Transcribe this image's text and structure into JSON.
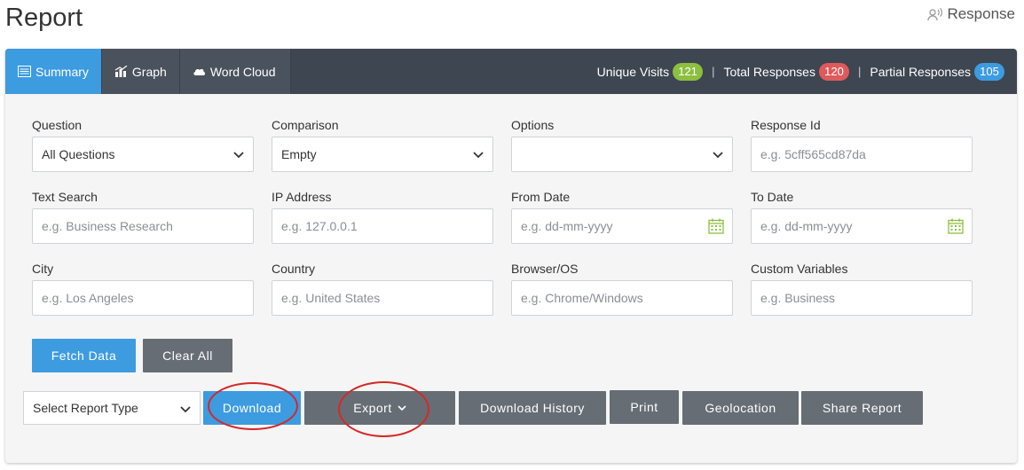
{
  "page": {
    "title": "Report",
    "response_link": "Response"
  },
  "tabs": [
    {
      "label": "Summary",
      "icon": "list-icon",
      "active": true
    },
    {
      "label": "Graph",
      "icon": "bar-chart-icon",
      "active": false
    },
    {
      "label": "Word Cloud",
      "icon": "cloud-icon",
      "active": false
    }
  ],
  "stats": {
    "unique_visits": {
      "label": "Unique Visits",
      "value": "121",
      "color": "#8cbf3f"
    },
    "total_responses": {
      "label": "Total Responses",
      "value": "120",
      "color": "#df5a5a"
    },
    "partial_responses": {
      "label": "Partial Responses",
      "value": "105",
      "color": "#3d9be0"
    }
  },
  "filters": {
    "question": {
      "label": "Question",
      "value": "All Questions"
    },
    "comparison": {
      "label": "Comparison",
      "value": "Empty"
    },
    "options": {
      "label": "Options",
      "value": ""
    },
    "response_id": {
      "label": "Response Id",
      "placeholder": "e.g. 5cff565cd87da"
    },
    "text_search": {
      "label": "Text Search",
      "placeholder": "e.g. Business Research"
    },
    "ip_address": {
      "label": "IP Address",
      "placeholder": "e.g. 127.0.0.1"
    },
    "from_date": {
      "label": "From Date",
      "placeholder": "e.g. dd-mm-yyyy"
    },
    "to_date": {
      "label": "To Date",
      "placeholder": "e.g. dd-mm-yyyy"
    },
    "city": {
      "label": "City",
      "placeholder": "e.g. Los Angeles"
    },
    "country": {
      "label": "Country",
      "placeholder": "e.g. United States"
    },
    "browser_os": {
      "label": "Browser/OS",
      "placeholder": "e.g. Chrome/Windows"
    },
    "custom_variables": {
      "label": "Custom Variables",
      "placeholder": "e.g. Business"
    }
  },
  "actions": {
    "fetch_data": "Fetch Data",
    "clear_all": "Clear All",
    "report_type": "Select Report Type",
    "download": "Download",
    "export": "Export",
    "download_history": "Download History",
    "print": "Print",
    "geolocation": "Geolocation",
    "share_report": "Share Report"
  },
  "colors": {
    "accent": "#3d9be0",
    "tabbar": "#3e4651",
    "button_gray": "#676d74",
    "annotation": "#d42828"
  }
}
